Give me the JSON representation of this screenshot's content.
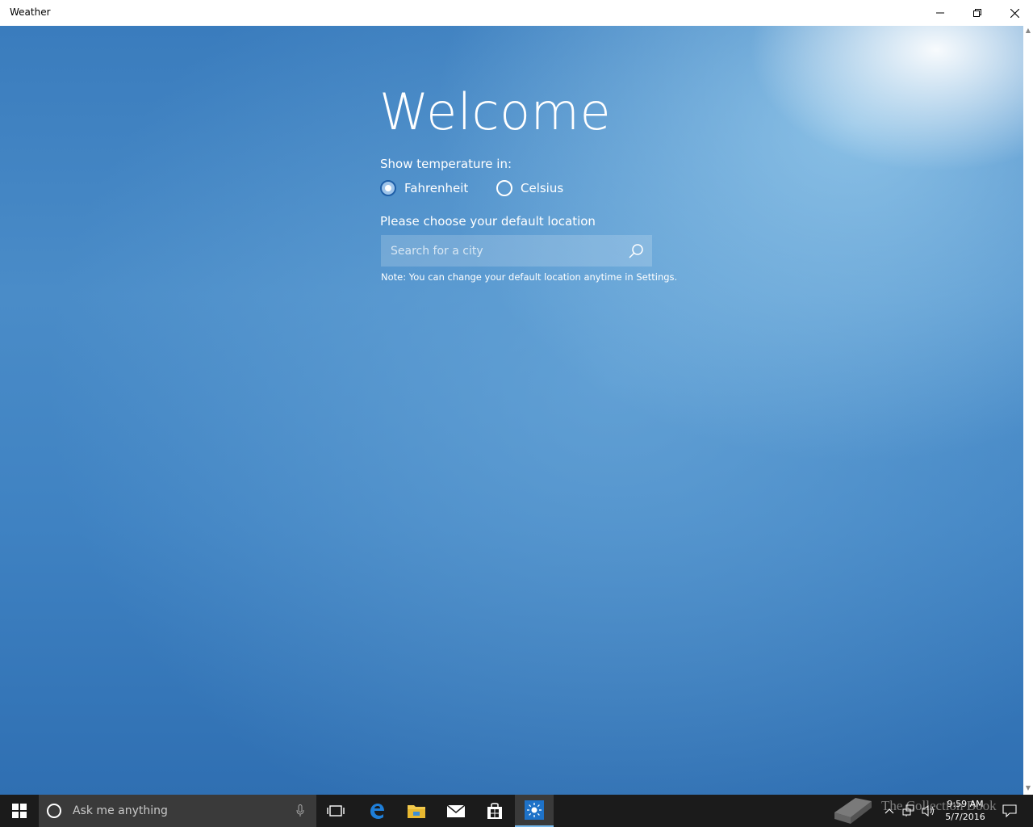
{
  "window": {
    "title": "Weather",
    "controls": {
      "minimize": "minimize",
      "restore": "restore",
      "close": "close"
    }
  },
  "welcome": {
    "heading": "Welcome",
    "temperature_prompt": "Show temperature in:",
    "units": [
      {
        "label": "Fahrenheit",
        "selected": true
      },
      {
        "label": "Celsius",
        "selected": false
      }
    ],
    "location_prompt": "Please choose your default location",
    "search": {
      "placeholder": "Search for a city",
      "value": ""
    },
    "note": "Note: You can change your default location anytime in Settings."
  },
  "taskbar": {
    "search_placeholder": "Ask me anything",
    "pinned": [
      "task-view",
      "edge",
      "file-explorer",
      "mail",
      "store",
      "weather"
    ],
    "active": "weather",
    "clock": {
      "time": "9:59 AM",
      "date": "5/7/2016"
    }
  },
  "watermark": "The Collection Book",
  "colors": {
    "background_top": "#3a7cbd",
    "background_bottom": "#2f6fb2",
    "taskbar": "#1b1b1b",
    "accent": "#76b9ed"
  }
}
